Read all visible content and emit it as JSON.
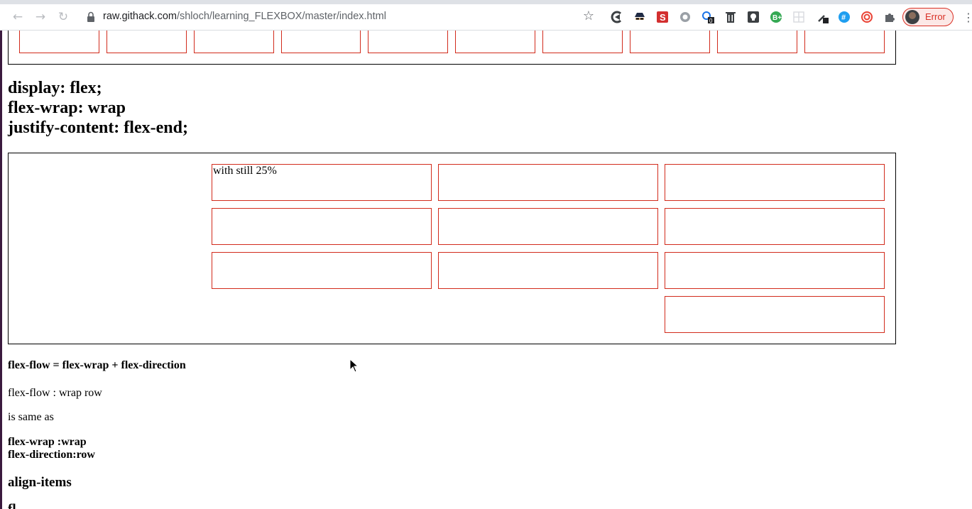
{
  "browser": {
    "url_host": "raw.githack.com",
    "url_path": "/shloch/learning_FLEXBOX/master/index.html",
    "profile_label": "Error",
    "extensions": [
      "ublock-icon",
      "spy-icon",
      "s-red-icon",
      "circle-icon",
      "badge-counter-icon",
      "trash-icon",
      "lightbulb-icon",
      "green-b-icon",
      "grid-icon",
      "dropper-icon",
      "hash-icon",
      "spiral-icon",
      "puzzle-icon"
    ],
    "extension_badge": "0",
    "accent_error": "#d93025"
  },
  "page": {
    "section1": {
      "heading_lines": [
        "display: flex;",
        "flex-wrap: wrap",
        "justify-content: flex-end;"
      ],
      "first_box_text": "with still 25%"
    },
    "flexflow": {
      "title": "flex-flow = flex-wrap + flex-direction",
      "line1": "flex-flow : wrap row",
      "line2": "is same as",
      "line3": "flex-wrap :wrap",
      "line4": "flex-direction:row"
    },
    "align_items": {
      "title": "align-items",
      "next_partial": "fl"
    },
    "colors": {
      "box_border": "#d22b1c",
      "container_border": "#000000"
    }
  }
}
